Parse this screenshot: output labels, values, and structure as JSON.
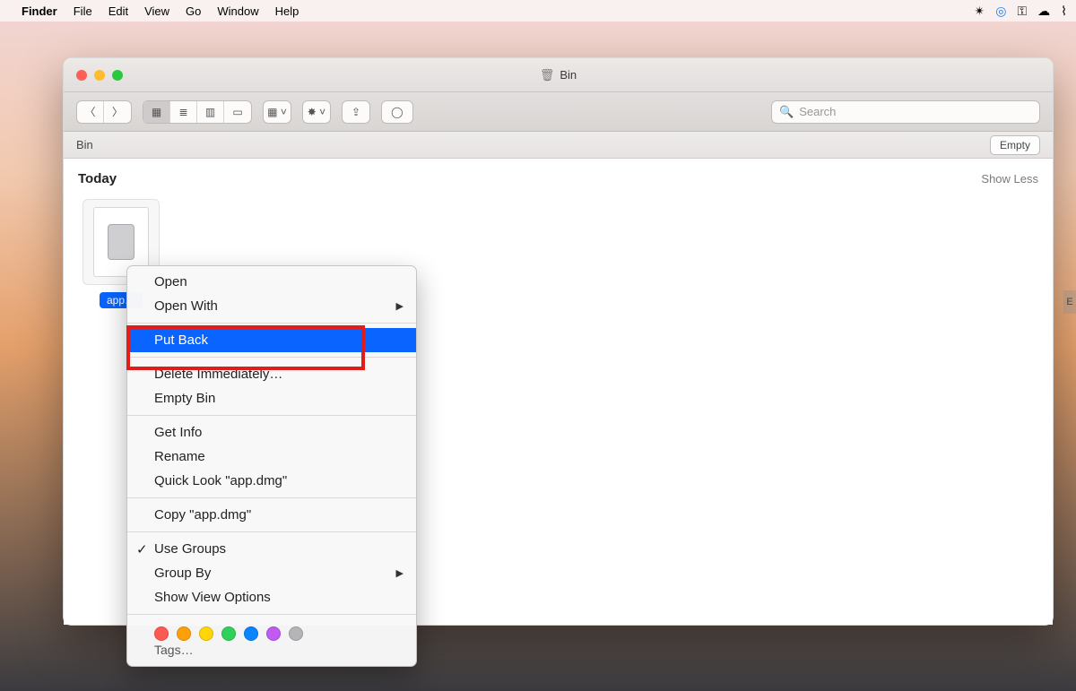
{
  "menubar": {
    "app": "Finder",
    "items": [
      "File",
      "Edit",
      "View",
      "Go",
      "Window",
      "Help"
    ],
    "status_icons": [
      "antivirus",
      "teamviewer",
      "key",
      "cloud",
      "wifi"
    ]
  },
  "window": {
    "title": "Bin",
    "path_label": "Bin",
    "empty_btn": "Empty",
    "search_placeholder": "Search",
    "section": "Today",
    "show_less": "Show Less",
    "file_name": "app…"
  },
  "context_menu": {
    "open": "Open",
    "open_with": "Open With",
    "put_back": "Put Back",
    "delete_now": "Delete Immediately…",
    "empty_bin": "Empty Bin",
    "get_info": "Get Info",
    "rename": "Rename",
    "quick_look": "Quick Look \"app.dmg\"",
    "copy": "Copy \"app.dmg\"",
    "use_groups": "Use Groups",
    "group_by": "Group By",
    "view_options": "Show View Options",
    "tags_label": "Tags…",
    "tag_colors": [
      "#ff5a52",
      "#ff9f0a",
      "#ffd60a",
      "#30d158",
      "#0a84ff",
      "#bf5af2",
      "#b5b5b8"
    ]
  }
}
